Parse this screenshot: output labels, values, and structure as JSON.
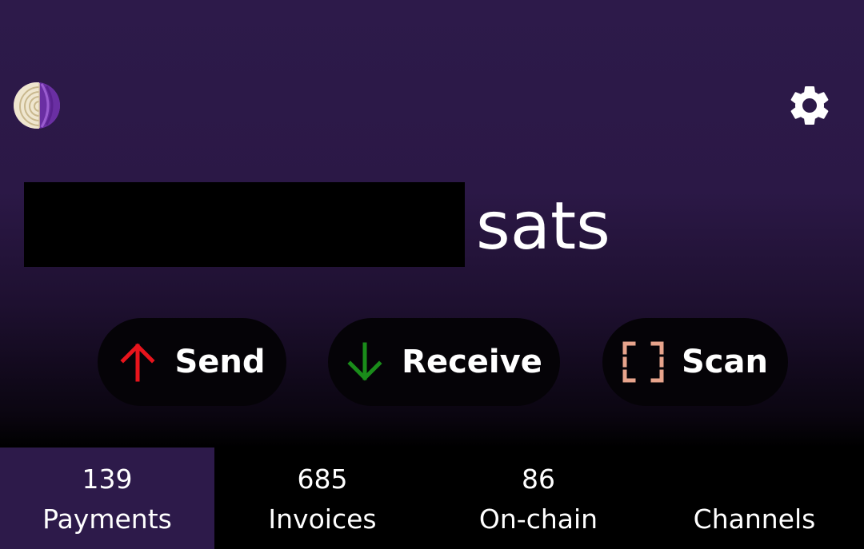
{
  "header": {
    "tor_icon": "tor-onion-icon",
    "settings_icon": "gear-icon"
  },
  "balance": {
    "unit": "sats"
  },
  "actions": {
    "send_label": "Send",
    "receive_label": "Receive",
    "scan_label": "Scan",
    "send_color": "#e8141c",
    "receive_color": "#1a8c1a",
    "scan_color": "#e8a48c"
  },
  "tabs": [
    {
      "count": "139",
      "label": "Payments"
    },
    {
      "count": "685",
      "label": "Invoices"
    },
    {
      "count": "86",
      "label": "On-chain"
    },
    {
      "count": "",
      "label": "Channels"
    }
  ],
  "colors": {
    "background": "#2d1a4a",
    "active_tab": "#2d1a4a"
  }
}
